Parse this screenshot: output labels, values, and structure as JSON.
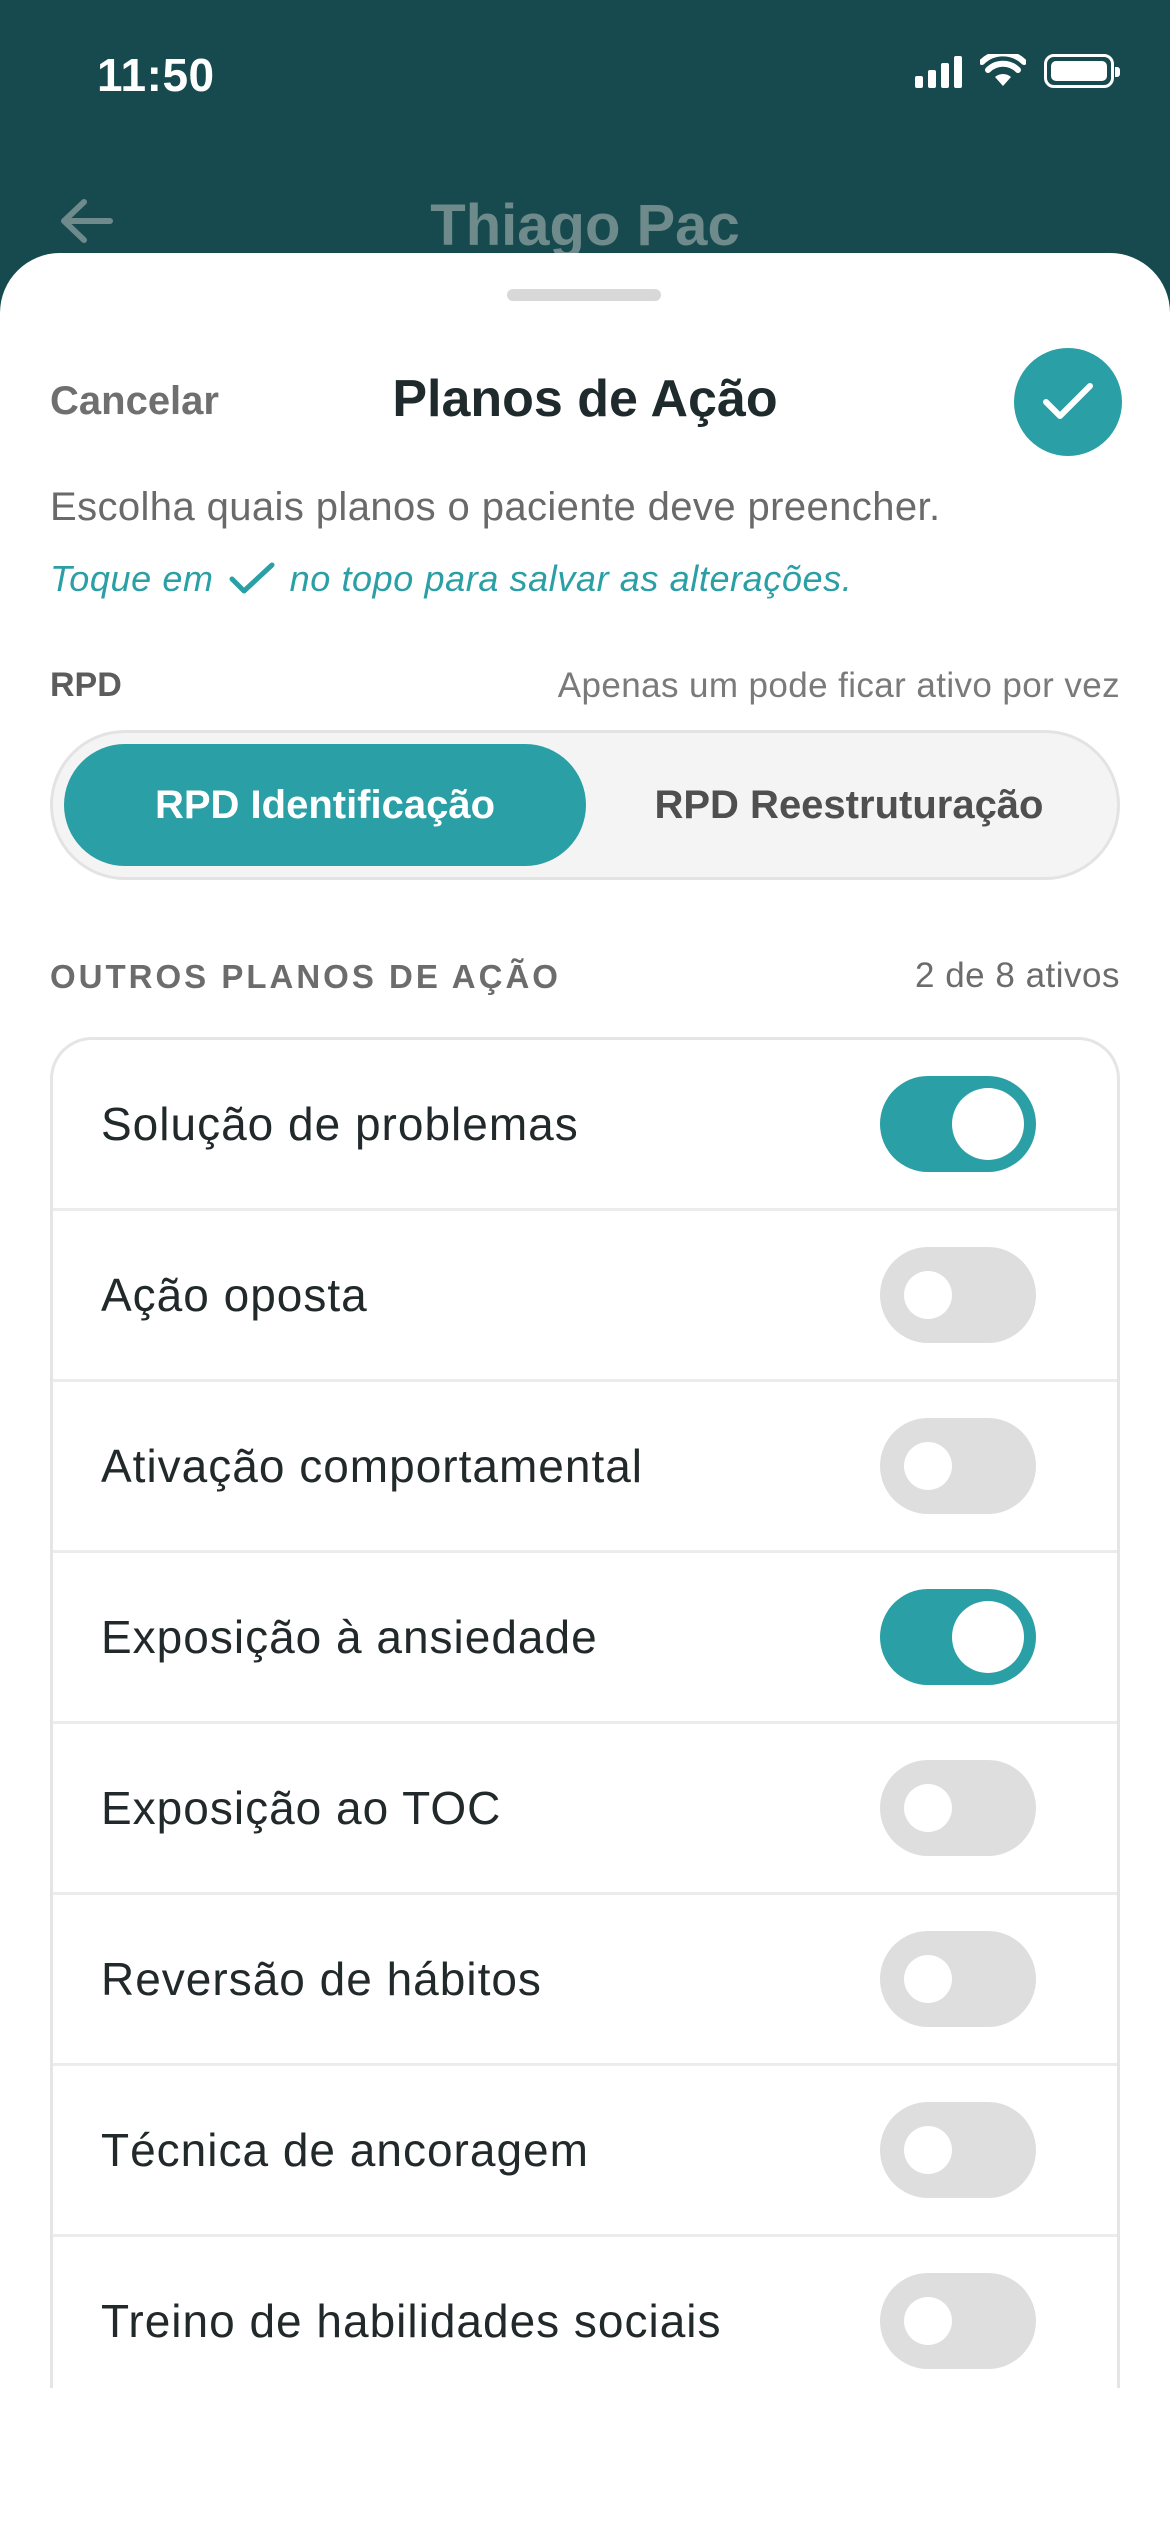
{
  "status_bar": {
    "time": "11:50"
  },
  "header": {
    "title": "Thiago Pac"
  },
  "sheet": {
    "cancel_label": "Cancelar",
    "title": "Planos de Ação",
    "description": "Escolha quais planos o paciente deve preencher.",
    "hint_before": "Toque em",
    "hint_after": "no topo para salvar as alterações."
  },
  "rpd": {
    "label": "RPD",
    "note": "Apenas um pode ficar ativo por vez",
    "options": [
      {
        "label": "RPD Identificação",
        "selected": true
      },
      {
        "label": "RPD Reestruturação",
        "selected": false
      }
    ]
  },
  "others": {
    "label": "OUTROS PLANOS DE AÇÃO",
    "count": "2 de 8 ativos",
    "items": [
      {
        "label": "Solução de problemas",
        "on": true
      },
      {
        "label": "Ação oposta",
        "on": false
      },
      {
        "label": "Ativação comportamental",
        "on": false
      },
      {
        "label": "Exposição à ansiedade",
        "on": true
      },
      {
        "label": "Exposição ao TOC",
        "on": false
      },
      {
        "label": "Reversão de hábitos",
        "on": false
      },
      {
        "label": "Técnica de ancoragem",
        "on": false
      },
      {
        "label": "Treino de habilidades sociais",
        "on": false
      }
    ]
  },
  "colors": {
    "accent": "#2a9fa5",
    "header_bg": "#174a4e"
  },
  "icons": {
    "back": "arrow-left-icon",
    "confirm": "checkmark-icon"
  }
}
